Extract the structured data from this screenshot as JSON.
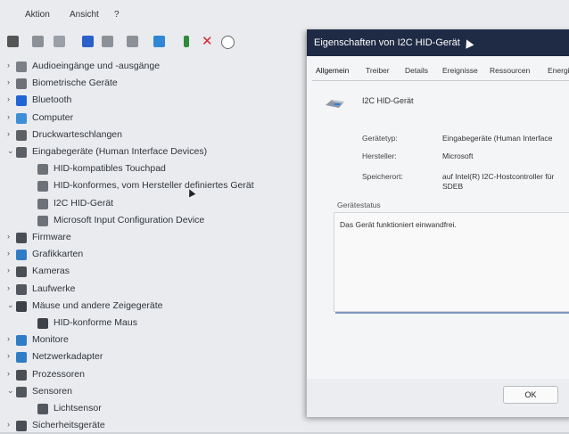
{
  "menubar": {
    "action": "Aktion",
    "view": "Ansicht",
    "help": "?"
  },
  "tree": [
    {
      "label": "Audioeingänge und -ausgänge",
      "expander": "›",
      "color": "#7b7f86"
    },
    {
      "label": "Biometrische Geräte",
      "expander": "›",
      "color": "#6e7278"
    },
    {
      "label": "Bluetooth",
      "expander": "›",
      "color": "#1f65d6"
    },
    {
      "label": "Computer",
      "expander": "›",
      "color": "#3e8fd8"
    },
    {
      "label": "Druckwarteschlangen",
      "expander": "›",
      "color": "#5c6168"
    },
    {
      "label": "Eingabegeräte (Human Interface Devices)",
      "expander": "⌄",
      "color": "#5b6067"
    },
    {
      "label": "HID-kompatibles Touchpad",
      "expander": "",
      "color": "#6d7178"
    },
    {
      "label": "HID-konformes, vom Hersteller definiertes Gerät",
      "expander": "",
      "color": "#6d7178"
    },
    {
      "label": "I2C HID-Gerät",
      "expander": "",
      "color": "#6d7178"
    },
    {
      "label": "Microsoft Input Configuration Device",
      "expander": "",
      "color": "#6d7178"
    },
    {
      "label": "Firmware",
      "expander": "›",
      "color": "#4a4f56"
    },
    {
      "label": "Grafikkarten",
      "expander": "›",
      "color": "#2f7cc7"
    },
    {
      "label": "Kameras",
      "expander": "›",
      "color": "#4a4f56"
    },
    {
      "label": "Laufwerke",
      "expander": "›",
      "color": "#53585f"
    },
    {
      "label": "Mäuse und andere Zeigegeräte",
      "expander": "⌄",
      "color": "#3d4148"
    },
    {
      "label": "HID-konforme Maus",
      "expander": "",
      "color": "#3d4148"
    },
    {
      "label": "Monitore",
      "expander": "›",
      "color": "#2f7cc7"
    },
    {
      "label": "Netzwerkadapter",
      "expander": "›",
      "color": "#2f7cc7"
    },
    {
      "label": "Prozessoren",
      "expander": "›",
      "color": "#4a4f56"
    },
    {
      "label": "Sensoren",
      "expander": "⌄",
      "color": "#53585f"
    },
    {
      "label": "Lichtsensor",
      "expander": "",
      "color": "#53585f"
    },
    {
      "label": "Sicherheitsgeräte",
      "expander": "›",
      "color": "#4a4f56"
    }
  ],
  "dialog": {
    "title": "Eigenschaften von I2C HID-Gerät",
    "tabs": [
      "Allgemein",
      "Treiber",
      "Details",
      "Ereignisse",
      "Ressourcen",
      "Energie"
    ],
    "device_name": "I2C HID-Gerät",
    "properties": [
      {
        "label": "Gerätetyp:",
        "value": "Eingabegeräte (Human Interface"
      },
      {
        "label": "Hersteller:",
        "value": "Microsoft"
      },
      {
        "label": "Speicherort:",
        "value": "auf Intel(R) I2C-Hostcontroller für SDEB"
      }
    ],
    "status_title": "Gerätestatus",
    "status_text": "Das Gerät funktioniert einwandfrei.",
    "ok_label": "OK"
  }
}
